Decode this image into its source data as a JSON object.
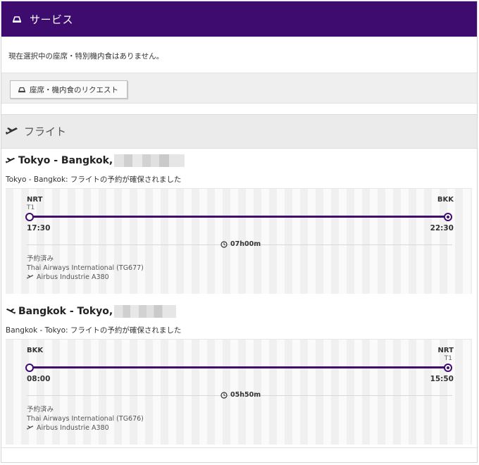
{
  "service": {
    "title": "サービス",
    "message": "現在選択中の座席・特別機内食はありません。",
    "request_button": "座席・機内食のリクエスト"
  },
  "flights": {
    "title": "フライト",
    "segments": [
      {
        "route": "Tokyo - Bangkok,",
        "status": "Tokyo - Bangkok: フライトの予約が確保されました",
        "dep_code": "NRT",
        "dep_terminal": "T1",
        "dep_time": "17:30",
        "arr_code": "BKK",
        "arr_terminal": "",
        "arr_time": "22:30",
        "duration": "07h00m",
        "booking_status": "予約済み",
        "carrier": "Thai Airways International (TG677)",
        "aircraft": "Airbus Industrie A380"
      },
      {
        "route": "Bangkok - Tokyo,",
        "status": "Bangkok - Tokyo: フライトの予約が確保されました",
        "dep_code": "BKK",
        "dep_terminal": "",
        "dep_time": "08:00",
        "arr_code": "NRT",
        "arr_terminal": "T1",
        "arr_time": "15:50",
        "duration": "05h50m",
        "booking_status": "予約済み",
        "carrier": "Thai Airways International (TG676)",
        "aircraft": "Airbus Industrie A380"
      }
    ]
  },
  "colors": {
    "brand_purple": "#3d0c6e",
    "header_gray": "#ebebeb"
  },
  "icons": {
    "service": "seat-icon",
    "flight": "airplane-icon",
    "outbound": "airplane-icon",
    "return": "airplane-return-icon",
    "duration": "clock-icon"
  }
}
